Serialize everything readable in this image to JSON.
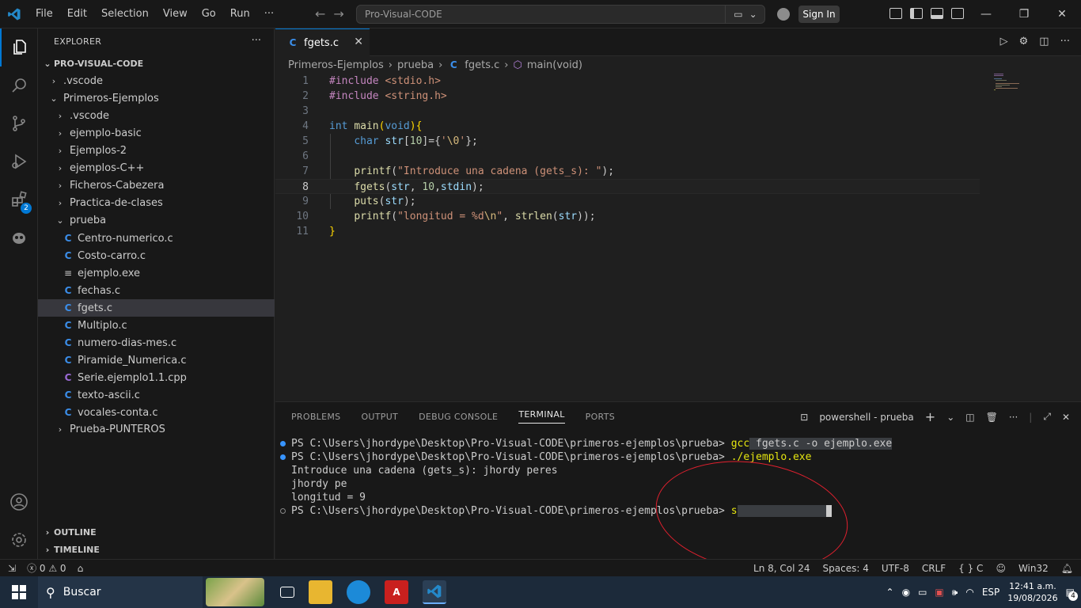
{
  "titlebar": {
    "menu": [
      "File",
      "Edit",
      "Selection",
      "View",
      "Go",
      "Run",
      "···"
    ],
    "search": "Pro-Visual-CODE",
    "sign_in": "Sign In"
  },
  "activity": {
    "extensions_badge": "2"
  },
  "explorer": {
    "title": "EXPLORER",
    "more": "···",
    "root": "PRO-VISUAL-CODE",
    "items": [
      {
        "label": ".vscode",
        "type": "folder",
        "open": false,
        "depth": 1
      },
      {
        "label": "Primeros-Ejemplos",
        "type": "folder",
        "open": true,
        "depth": 1
      },
      {
        "label": ".vscode",
        "type": "folder",
        "open": false,
        "depth": 2
      },
      {
        "label": "ejemplo-basic",
        "type": "folder",
        "open": false,
        "depth": 2
      },
      {
        "label": "Ejemplos-2",
        "type": "folder",
        "open": false,
        "depth": 2
      },
      {
        "label": "ejemplos-C++",
        "type": "folder",
        "open": false,
        "depth": 2
      },
      {
        "label": "Ficheros-Cabezera",
        "type": "folder",
        "open": false,
        "depth": 2
      },
      {
        "label": "Practica-de-clases",
        "type": "folder",
        "open": false,
        "depth": 2
      },
      {
        "label": "prueba",
        "type": "folder",
        "open": true,
        "depth": 2
      },
      {
        "label": "Centro-numerico.c",
        "type": "c",
        "depth": 3
      },
      {
        "label": "Costo-carro.c",
        "type": "c",
        "depth": 3
      },
      {
        "label": "ejemplo.exe",
        "type": "exe",
        "depth": 3
      },
      {
        "label": "fechas.c",
        "type": "c",
        "depth": 3
      },
      {
        "label": "fgets.c",
        "type": "c",
        "depth": 3,
        "selected": true
      },
      {
        "label": "Multiplo.c",
        "type": "c",
        "depth": 3
      },
      {
        "label": "numero-dias-mes.c",
        "type": "c",
        "depth": 3
      },
      {
        "label": "Piramide_Numerica.c",
        "type": "c",
        "depth": 3
      },
      {
        "label": "Serie.ejemplo1.1.cpp",
        "type": "cpp",
        "depth": 3
      },
      {
        "label": "texto-ascii.c",
        "type": "c",
        "depth": 3
      },
      {
        "label": "vocales-conta.c",
        "type": "c",
        "depth": 3
      },
      {
        "label": "Prueba-PUNTEROS",
        "type": "folder",
        "open": false,
        "depth": 2
      }
    ],
    "outline": "OUTLINE",
    "timeline": "TIMELINE"
  },
  "editor": {
    "tab": "fgets.c",
    "tab_icon": "C",
    "breadcrumb": [
      "Primeros-Ejemplos",
      "prueba",
      "fgets.c",
      "main(void)"
    ],
    "cursor_line": 8
  },
  "panel": {
    "tabs": [
      "PROBLEMS",
      "OUTPUT",
      "DEBUG CONSOLE",
      "TERMINAL",
      "PORTS"
    ],
    "active_tab": "TERMINAL",
    "shell": "powershell - prueba",
    "terminal": {
      "prompt": "PS C:\\Users\\jhordype\\Desktop\\Pro-Visual-CODE\\primeros-ejemplos\\prueba>",
      "cmd1": "gcc",
      "cmd1_rest": " fgets.c -o ejemplo.exe",
      "cmd2": "./ejemplo.exe",
      "out1": "Introduce una cadena (gets_s): jhordy peres",
      "out2": "jhordy pe",
      "out3": "longitud = 9",
      "typed": "s"
    }
  },
  "statusbar": {
    "errors": "0",
    "warnings": "0",
    "position": "Ln 8, Col 24",
    "spaces": "Spaces: 4",
    "encoding": "UTF-8",
    "eol": "CRLF",
    "language": "C",
    "platform": "Win32"
  },
  "taskbar": {
    "search": "Buscar",
    "lang": "ESP",
    "time": "12:41 a.m.",
    "date": "19/08/2026",
    "notifications": "4"
  },
  "colors": {
    "accent": "#0078d4",
    "c_icon": "#3b8eea",
    "annotation": "#e0202e"
  }
}
